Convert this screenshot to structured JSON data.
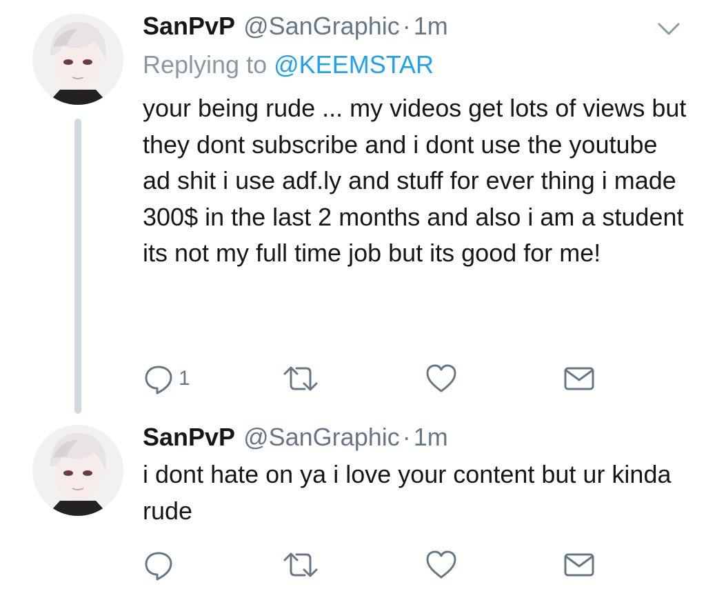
{
  "tweets": [
    {
      "display_name": "SanPvP",
      "handle": "@SanGraphic",
      "separator": "·",
      "time": "1m",
      "replying_prefix": "Replying to",
      "replying_to": "@KEEMSTAR",
      "text": "your being rude ... my videos get lots of views but they dont subscribe and i dont use the youtube ad shit i use adf.ly and stuff for ever thing i made 300$ in the last 2 months and also i am a student its not my full time job but its good for me!",
      "reply_count": "1",
      "actions": [
        "reply-icon",
        "retweet-icon",
        "like-icon",
        "direct-message-icon"
      ]
    },
    {
      "display_name": "SanPvP",
      "handle": "@SanGraphic",
      "separator": "·",
      "time": "1m",
      "text": "i dont hate on ya i love your content but ur kinda rude",
      "actions": [
        "reply-icon",
        "retweet-icon",
        "like-icon",
        "direct-message-icon"
      ]
    }
  ],
  "colors": {
    "text": "#14171a",
    "secondary": "#657786",
    "link": "#1da1f2",
    "thread_line": "#cfd9de"
  }
}
